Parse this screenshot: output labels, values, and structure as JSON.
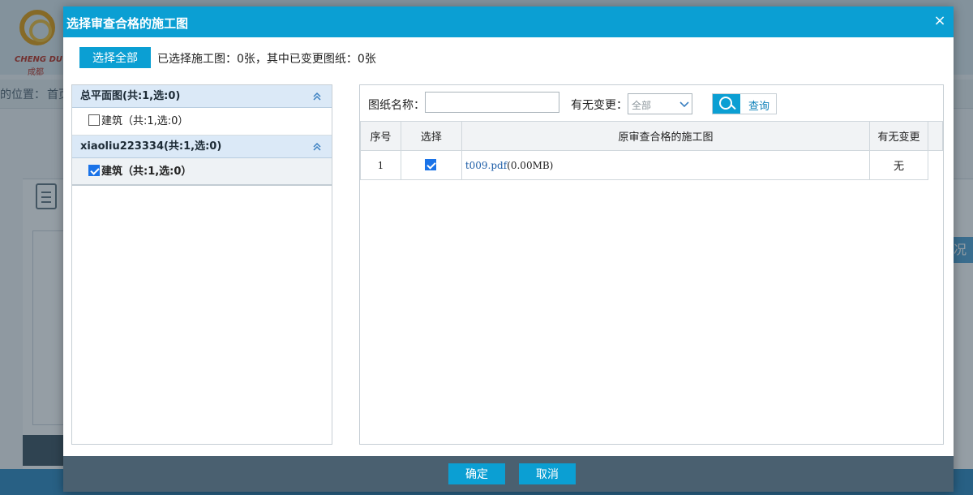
{
  "background": {
    "logo_text": "CHENG DU",
    "logo_sub": "成都",
    "breadcrumb_label": "的位置：",
    "breadcrumb_home": "首页",
    "right_button": "况"
  },
  "dialog": {
    "title": "选择审查合格的施工图",
    "close_glyph": "×",
    "select_all_label": "选择全部",
    "summary": "已选择施工图：0张，其中已变更图纸：0张"
  },
  "tree": {
    "groups": [
      {
        "title": "总平面图(共:1,选:0)",
        "item": "建筑（共:1,选:0）",
        "checked": false
      },
      {
        "title": "xiaoliu223334(共:1,选:0)",
        "item": "建筑（共:1,选:0）",
        "checked": true
      }
    ]
  },
  "filter": {
    "name_label": "图纸名称：",
    "name_value": "",
    "change_label": "有无变更：",
    "change_value": "全部",
    "search_label": "查询"
  },
  "table": {
    "headers": [
      "序号",
      "选择",
      "原审查合格的施工图",
      "有无变更"
    ],
    "rows": [
      {
        "no": "1",
        "selected": true,
        "file": "t009.pdf",
        "size": "(0.00MB)",
        "change": "无"
      }
    ]
  },
  "footer": {
    "ok_label": "确定",
    "cancel_label": "取消"
  },
  "colors": {
    "primary": "#0b9fd3",
    "footer": "#4a6070",
    "group_header": "#dbe9f7"
  }
}
